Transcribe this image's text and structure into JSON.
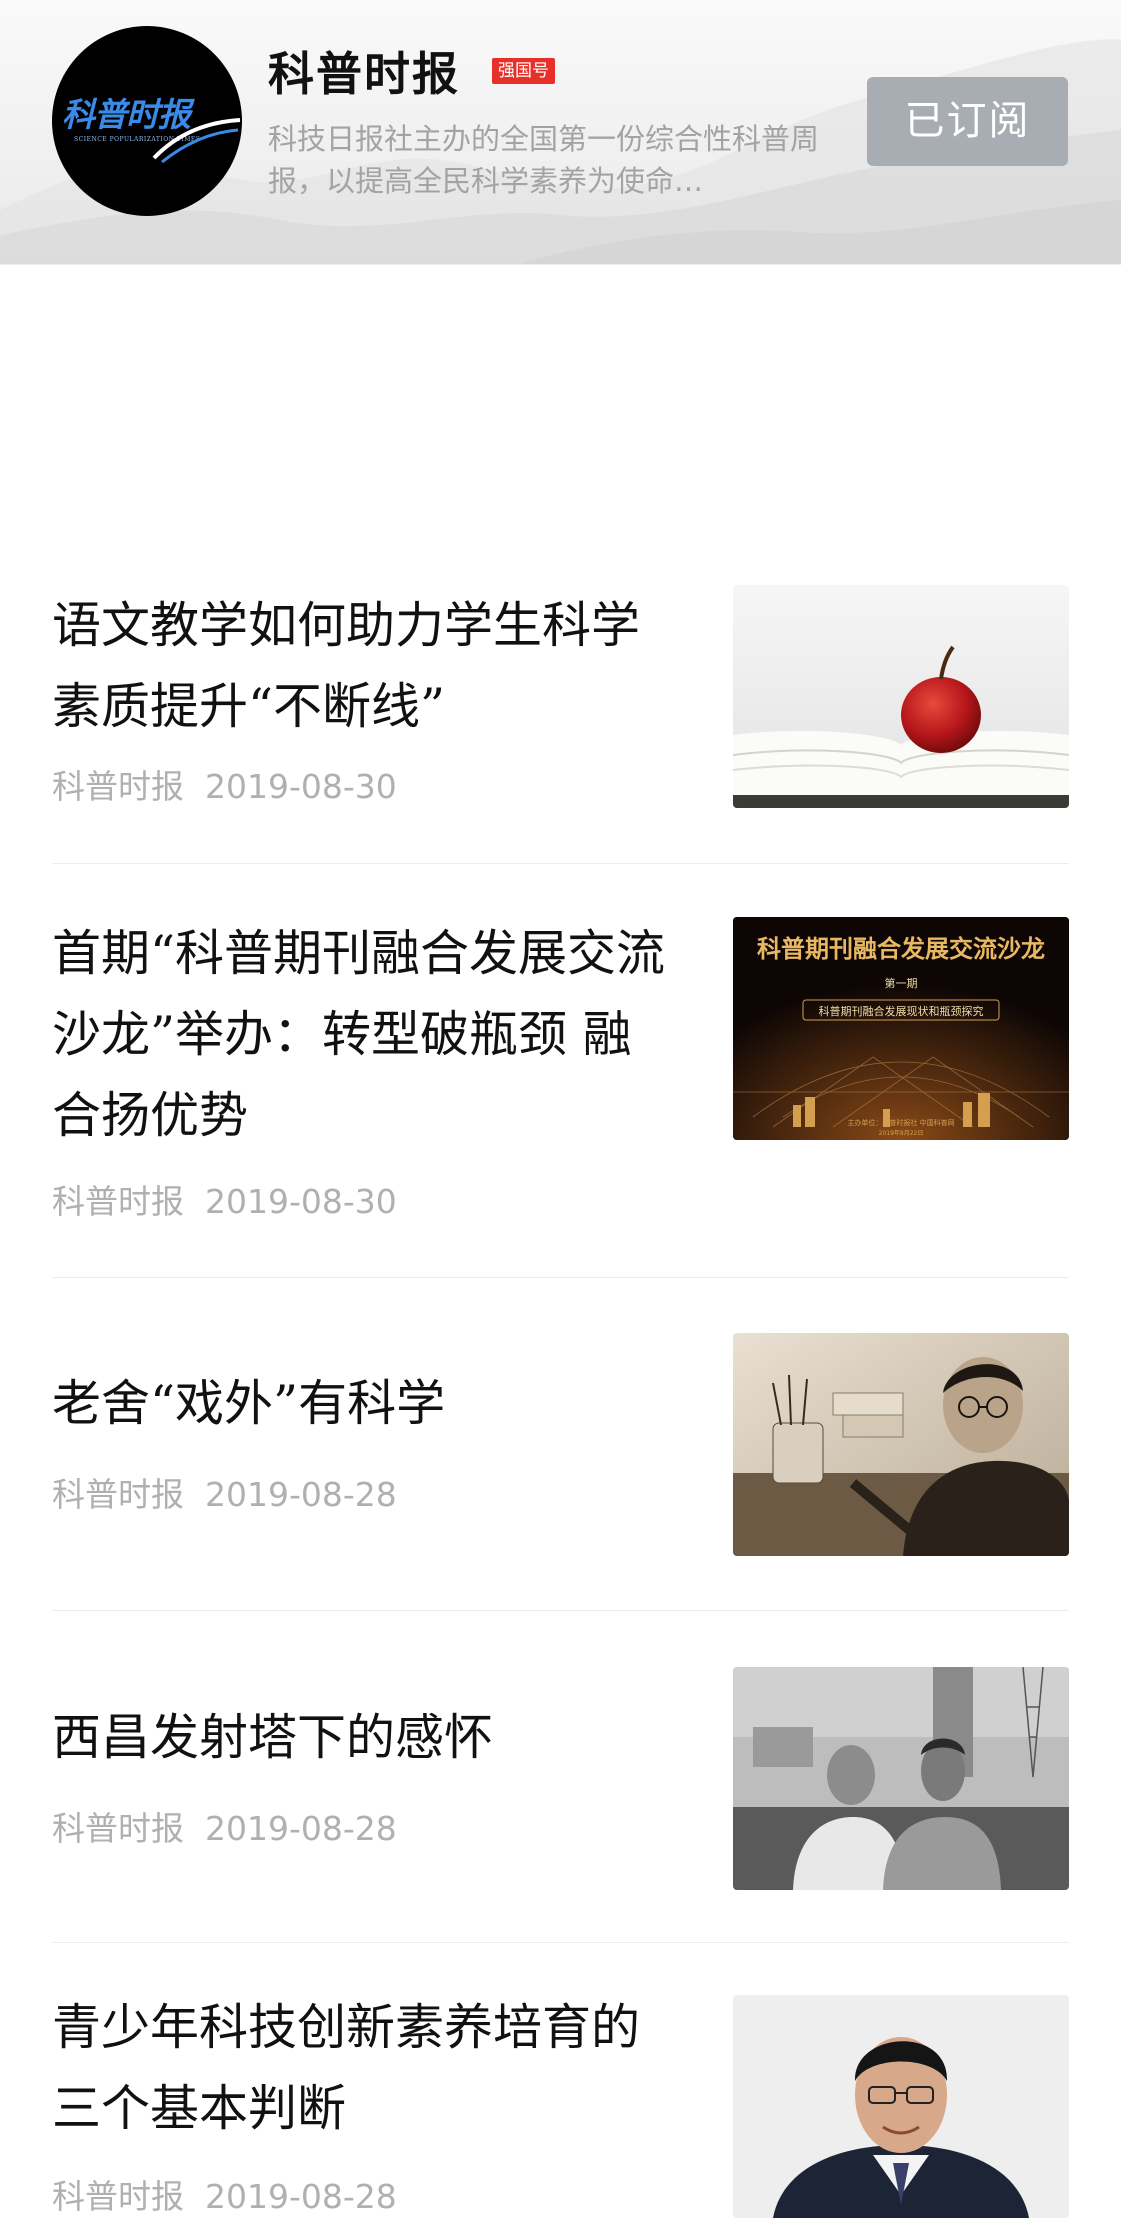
{
  "account": {
    "logo_text": "科普时报",
    "logo_subtext": "SCIENCE POPULARIZATION TIMES",
    "name": "科普时报",
    "badge": "强国号",
    "description": "科技日报社主办的全国第一份综合性科普周报，以提高全民科学素养为使命…",
    "subscribe_label": "已订阅"
  },
  "articles": [
    {
      "title": "语文教学如何助力学生科学素质提升“不断线”",
      "source": "科普时报",
      "date": "2019-08-30",
      "thumb_icon": "apple-on-book-image"
    },
    {
      "title": "首期“科普期刊融合发展交流沙龙”举办：转型破瓶颈 融合扬优势",
      "source": "科普时报",
      "date": "2019-08-30",
      "thumb_icon": "salon-poster-image",
      "thumb_title": "科普期刊融合发展交流沙龙",
      "thumb_badge": "第一期",
      "thumb_sub": "科普期刊融合发展现状和瓶颈探究",
      "thumb_footer": "主办单位：科普时报社  中国科普网",
      "thumb_date": "2019年8月22日"
    },
    {
      "title": "老舍“戏外”有科学",
      "source": "科普时报",
      "date": "2019-08-28",
      "thumb_icon": "man-writing-photo"
    },
    {
      "title": "西昌发射塔下的感怀",
      "source": "科普时报",
      "date": "2019-08-28",
      "thumb_icon": "two-men-photo"
    },
    {
      "title": "青少年科技创新素养培育的三个基本判断",
      "source": "科普时报",
      "date": "2019-08-28",
      "thumb_icon": "portrait-photo"
    }
  ]
}
